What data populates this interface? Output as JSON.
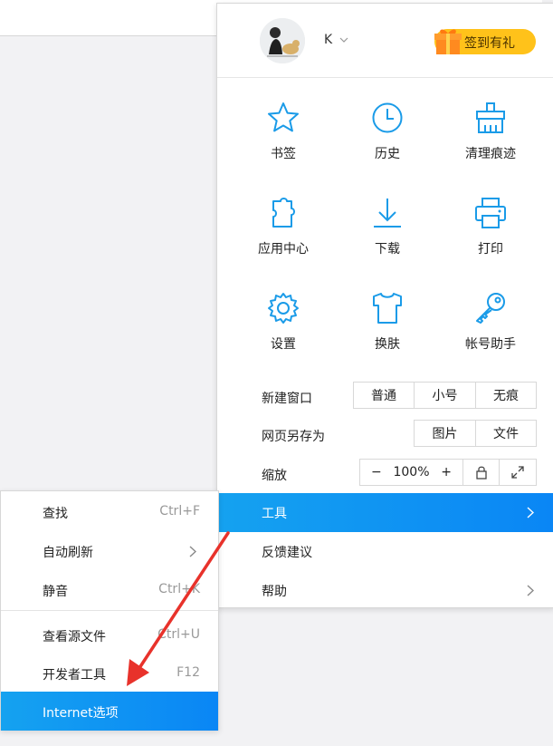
{
  "profile": {
    "username": "K",
    "signin_label": "签到有礼"
  },
  "grid": [
    {
      "label": "书签",
      "icon": "star-icon"
    },
    {
      "label": "历史",
      "icon": "clock-icon"
    },
    {
      "label": "清理痕迹",
      "icon": "broom-icon"
    },
    {
      "label": "应用中心",
      "icon": "puzzle-icon"
    },
    {
      "label": "下载",
      "icon": "download-icon"
    },
    {
      "label": "打印",
      "icon": "printer-icon"
    },
    {
      "label": "设置",
      "icon": "gear-icon"
    },
    {
      "label": "换肤",
      "icon": "tshirt-icon"
    },
    {
      "label": "帐号助手",
      "icon": "key-icon"
    }
  ],
  "new_window": {
    "label": "新建窗口",
    "options": [
      "普通",
      "小号",
      "无痕"
    ]
  },
  "save_as": {
    "label": "网页另存为",
    "options": [
      "图片",
      "文件"
    ]
  },
  "zoom": {
    "label": "缩放",
    "minus": "−",
    "value": "100%",
    "plus": "+"
  },
  "menu": {
    "tools": "工具",
    "feedback": "反馈建议",
    "help": "帮助"
  },
  "submenu": [
    {
      "label": "查找",
      "shortcut": "Ctrl+F"
    },
    {
      "label": "自动刷新",
      "shortcut": ""
    },
    {
      "label": "静音",
      "shortcut": "Ctrl+K"
    },
    {
      "label": "查看源文件",
      "shortcut": "Ctrl+U"
    },
    {
      "label": "开发者工具",
      "shortcut": "F12"
    },
    {
      "label": "Internet选项",
      "shortcut": ""
    }
  ],
  "colors": {
    "accent": "#0a86f5",
    "icon": "#1a9be8",
    "signin": "#ffc21a",
    "annotation_arrow": "#e8322b"
  }
}
